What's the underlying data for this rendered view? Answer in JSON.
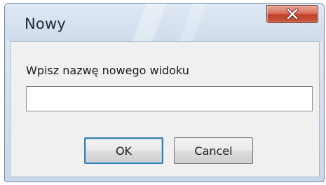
{
  "dialog": {
    "title": "Nowy",
    "close_icon": "close-icon",
    "prompt_label": "Wpisz nazwę nowego widoku",
    "name_input": {
      "value": "",
      "placeholder": ""
    },
    "buttons": {
      "ok_label": "OK",
      "cancel_label": "Cancel"
    }
  },
  "colors": {
    "close_button": "#c1402a",
    "default_button_border": "#3c7fb1",
    "client_background": "#f0f0f0"
  }
}
